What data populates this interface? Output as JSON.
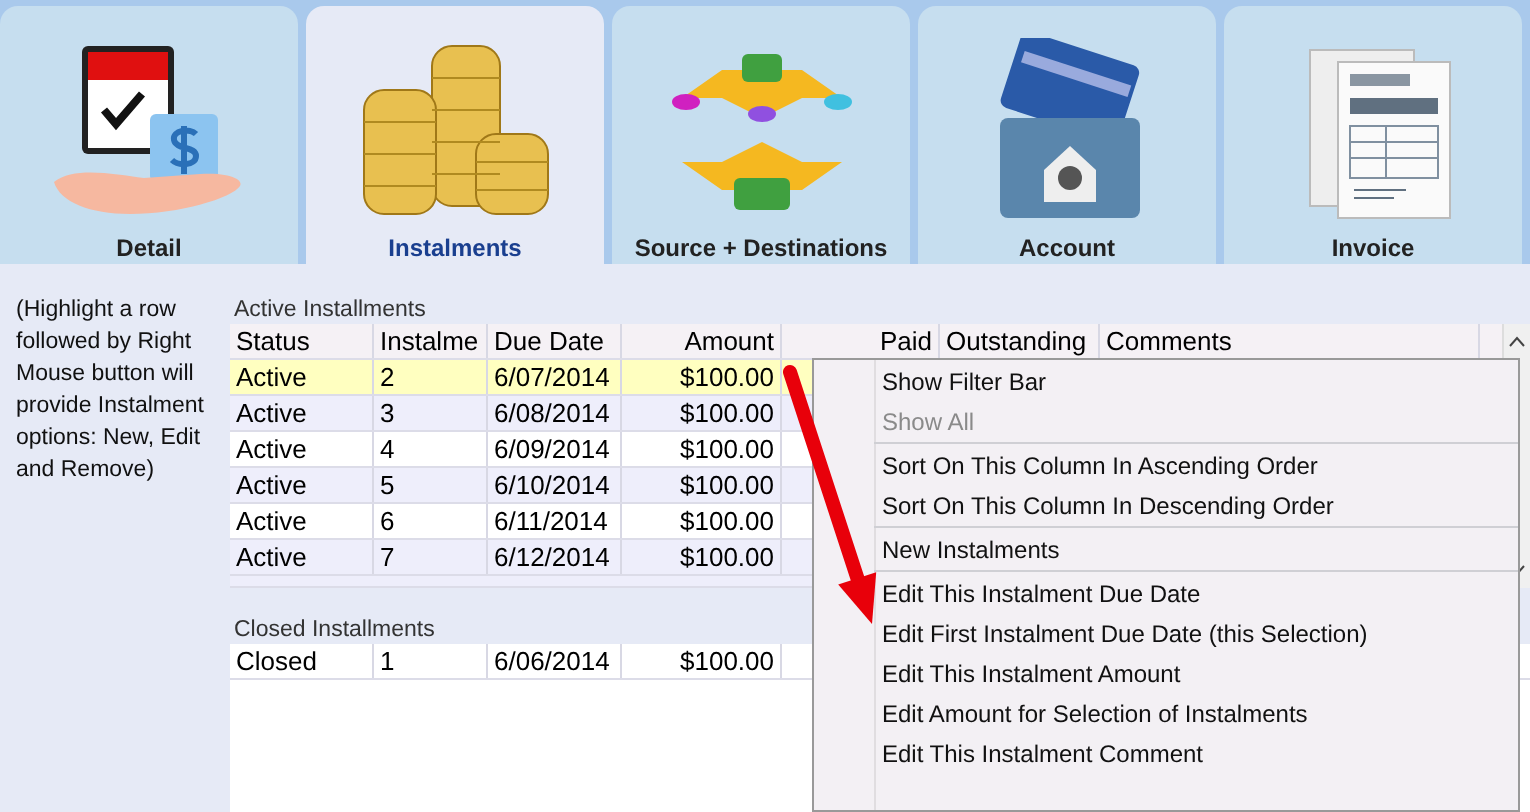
{
  "tabs": [
    {
      "label": "Detail",
      "selected": false,
      "kind": "calendar"
    },
    {
      "label": "Instalments",
      "selected": true,
      "kind": "coins"
    },
    {
      "label": "Source + Destinations",
      "selected": false,
      "kind": "flows"
    },
    {
      "label": "Account",
      "selected": false,
      "kind": "card"
    },
    {
      "label": "Invoice",
      "selected": false,
      "kind": "invoice"
    }
  ],
  "note": "(Highlight a row followed by Right Mouse button will provide Instalment options: New, Edit and Remove)",
  "active_installments": {
    "title": "Active Installments",
    "columns": [
      "Status",
      "Instalme",
      "Due Date",
      "Amount",
      "Paid",
      "Outstanding",
      "Comments"
    ],
    "rows": [
      {
        "cells": [
          "Active",
          "2",
          "6/07/2014",
          "$100.00"
        ],
        "selected": true
      },
      {
        "cells": [
          "Active",
          "3",
          "6/08/2014",
          "$100.00"
        ],
        "selected": false
      },
      {
        "cells": [
          "Active",
          "4",
          "6/09/2014",
          "$100.00"
        ],
        "selected": false
      },
      {
        "cells": [
          "Active",
          "5",
          "6/10/2014",
          "$100.00"
        ],
        "selected": false
      },
      {
        "cells": [
          "Active",
          "6",
          "6/11/2014",
          "$100.00"
        ],
        "selected": false
      },
      {
        "cells": [
          "Active",
          "7",
          "6/12/2014",
          "$100.00"
        ],
        "selected": false
      }
    ]
  },
  "closed_installments": {
    "title": "Closed Installments",
    "rows": [
      {
        "cells": [
          "Closed",
          "1",
          "6/06/2014",
          "$100.00"
        ],
        "selected": false
      }
    ]
  },
  "context_menu": {
    "groups": [
      [
        {
          "label": "Show Filter Bar",
          "disabled": false
        },
        {
          "label": "Show All",
          "disabled": true
        }
      ],
      [
        {
          "label": "Sort On This Column In Ascending Order",
          "disabled": false
        },
        {
          "label": "Sort On This Column In Descending Order",
          "disabled": false
        }
      ],
      [
        {
          "label": "New Instalments",
          "disabled": false
        }
      ],
      [
        {
          "label": "Edit This Instalment Due Date",
          "disabled": false
        },
        {
          "label": "Edit First Instalment Due Date (this Selection)",
          "disabled": false
        },
        {
          "label": "Edit This Instalment Amount",
          "disabled": false
        },
        {
          "label": "Edit Amount for Selection of Instalments",
          "disabled": false
        },
        {
          "label": "Edit This Instalment Comment",
          "disabled": false
        }
      ]
    ]
  }
}
